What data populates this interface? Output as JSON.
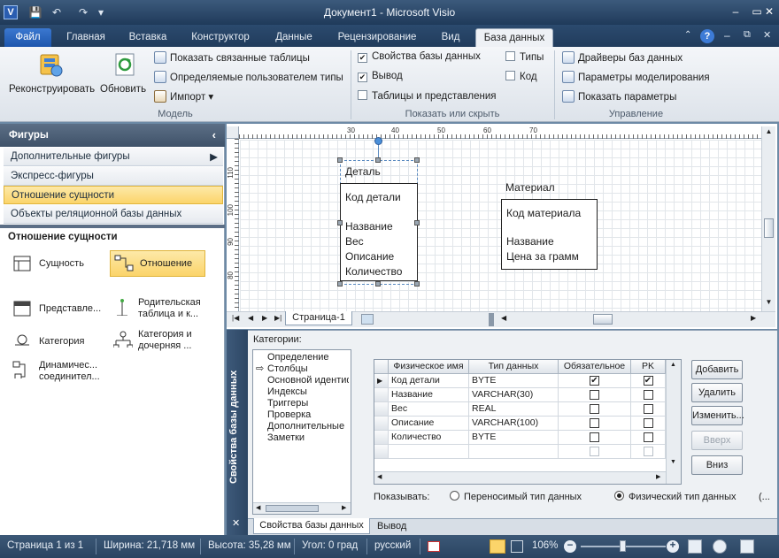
{
  "window": {
    "title": "Документ1  -  Microsoft Visio",
    "app_icon": "V"
  },
  "tabs": [
    "Файл",
    "Главная",
    "Вставка",
    "Конструктор",
    "Данные",
    "Рецензирование",
    "Вид",
    "База данных"
  ],
  "ribbon": {
    "model": {
      "group_label": "Модель",
      "reverse": "Реконструировать",
      "refresh": "Обновить",
      "show_related": "Показать связанные таблицы",
      "user_types": "Определяемые пользователем типы",
      "import": "Импорт"
    },
    "show_hide": {
      "group_label": "Показать или скрыть",
      "db_props": "Свойства базы данных",
      "output": "Вывод",
      "tables_views": "Таблицы и представления",
      "types": "Типы",
      "code": "Код"
    },
    "manage": {
      "group_label": "Управление",
      "drivers": "Драйверы баз данных",
      "modeling": "Параметры моделирования",
      "display": "Показать параметры"
    }
  },
  "shapes": {
    "title": "Фигуры",
    "stencils": [
      "Дополнительные фигуры",
      "Экспресс-фигуры",
      "Отношение сущности",
      "Объекты реляционной базы данных"
    ],
    "section": "Отношение сущности",
    "items": {
      "entity": "Сущность",
      "relationship": "Отношение",
      "view": "Представле...",
      "parent_l1": "Родительская",
      "parent_l2": "таблица и к...",
      "category": "Категория",
      "catchild_l1": "Категория и",
      "catchild_l2": "дочерняя ...",
      "dyn_l1": "Динамичес...",
      "dyn_l2": "соединител..."
    }
  },
  "ruler": {
    "top": [
      "30",
      "40",
      "50",
      "60",
      "70"
    ],
    "left": [
      "110",
      "100",
      "90",
      "80"
    ]
  },
  "diagram": {
    "e1": {
      "title": "Деталь",
      "pk": "Код детали",
      "fields": [
        "Название",
        "Вес",
        "Описание",
        "Количество"
      ]
    },
    "e2": {
      "title": "Материал",
      "pk": "Код материала",
      "fields": [
        "Название",
        "Цена за грамм"
      ]
    }
  },
  "page_tab": "Страница-1",
  "dbprops": {
    "side_title": "Свойства базы данных",
    "categories_label": "Категории:",
    "categories": [
      "Определение",
      "Столбцы",
      "Основной идентиф",
      "Индексы",
      "Триггеры",
      "Проверка",
      "Дополнительные",
      "Заметки"
    ],
    "headers": [
      "Физическое имя",
      "Тип данных",
      "Обязательное",
      "PK"
    ],
    "rows": [
      {
        "name": "Код детали",
        "type": "BYTE",
        "req": "✔",
        "pk": "✔"
      },
      {
        "name": "Название",
        "type": "VARCHAR(30)",
        "req": "",
        "pk": ""
      },
      {
        "name": "Вес",
        "type": "REAL",
        "req": "",
        "pk": ""
      },
      {
        "name": "Описание",
        "type": "VARCHAR(100)",
        "req": "",
        "pk": ""
      },
      {
        "name": "Количество",
        "type": "BYTE",
        "req": "",
        "pk": ""
      }
    ],
    "buttons": {
      "add": "Добавить",
      "delete": "Удалить",
      "edit": "Изменить...",
      "up": "Вверх",
      "down": "Вниз"
    },
    "show_label": "Показывать:",
    "radio_portable": "Переносимый тип данных",
    "radio_physical": "Физический тип данных",
    "ellipsis": "(...",
    "bottom_tabs": [
      "Свойства базы данных",
      "Вывод"
    ]
  },
  "status": {
    "page": "Страница 1 из 1",
    "width": "Ширина: 21,718 мм",
    "height": "Высота: 35,28 мм",
    "angle": "Угол: 0 град",
    "lang": "русский",
    "zoom": "106%"
  }
}
